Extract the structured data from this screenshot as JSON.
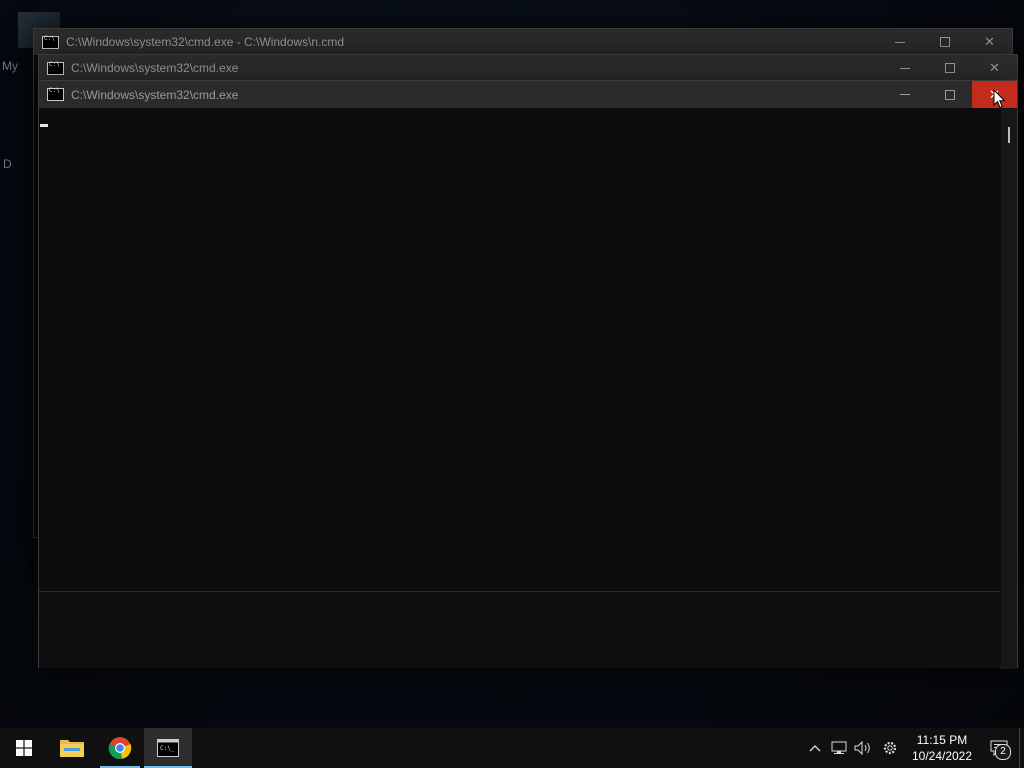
{
  "desktop": {
    "icon_label_1": "My",
    "icon_label_2": "D"
  },
  "windows": [
    {
      "title": "C:\\Windows\\system32\\cmd.exe - C:\\Windows\\n.cmd"
    },
    {
      "title": "C:\\Windows\\system32\\cmd.exe"
    },
    {
      "title": "C:\\Windows\\system32\\cmd.exe"
    }
  ],
  "titlebar_buttons": {
    "minimize": "minimize-icon",
    "maximize": "maximize-icon",
    "close": "close-icon"
  },
  "taskbar": {
    "start": "windows-start-icon",
    "apps": [
      "file-explorer-icon",
      "chrome-icon",
      "cmd-icon"
    ],
    "clock_time": "11:15 PM",
    "clock_date": "10/24/2022",
    "notification_count": "2"
  },
  "colors": {
    "close_hover": "#c42b1c",
    "taskbar": "#101010",
    "titlebar": "#2b2b2b",
    "accent": "#76b9ed"
  }
}
